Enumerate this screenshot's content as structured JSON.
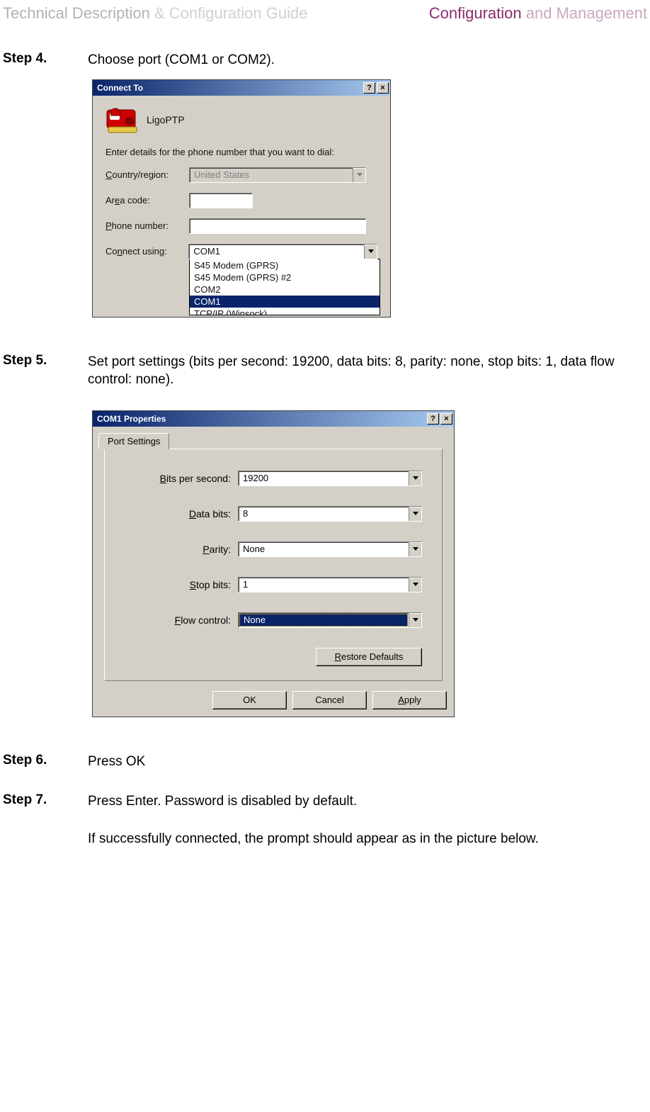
{
  "header": {
    "left_a": "Technical Description",
    "left_b": " & Configuration Guide",
    "right_a": "Configuration",
    "right_b": " and Management"
  },
  "steps": {
    "s4": {
      "label": "Step 4.",
      "text": "Choose port (COM1 or COM2)."
    },
    "s5": {
      "label": "Step 5.",
      "text": "Set port settings (bits per second: 19200, data bits: 8, parity: none, stop bits: 1, data flow control: none)."
    },
    "s6": {
      "label": "Step 6.",
      "text": "Press OK"
    },
    "s7": {
      "label": "Step 7.",
      "text": "Press Enter. Password is disabled by default."
    },
    "note": "If successfully connected, the prompt should appear as in the picture below."
  },
  "dialog_connect": {
    "title": "Connect To",
    "help_btn": "?",
    "close_btn": "×",
    "name": "LigoPTP",
    "instruction": "Enter details for the phone number that you want to dial:",
    "labels": {
      "country": "Country/region:",
      "area": "Area code:",
      "phone": "Phone number:",
      "connect": "Connect using:"
    },
    "values": {
      "country": "United States",
      "area": "",
      "phone": "",
      "connect": "COM1"
    },
    "options": [
      "S45 Modem (GPRS)",
      "S45 Modem (GPRS) #2",
      "COM2",
      "COM1",
      "TCP/IP (Winsock)"
    ]
  },
  "dialog_props": {
    "title": "COM1 Properties",
    "help_btn": "?",
    "close_btn": "×",
    "tab": "Port Settings",
    "labels": {
      "bps": "Bits per second:",
      "databits": "Data bits:",
      "parity": "Parity:",
      "stopbits": "Stop bits:",
      "flow": "Flow control:"
    },
    "values": {
      "bps": "19200",
      "databits": "8",
      "parity": "None",
      "stopbits": "1",
      "flow": "None"
    },
    "restore": "Restore Defaults",
    "ok": "OK",
    "cancel": "Cancel",
    "apply": "Apply"
  }
}
